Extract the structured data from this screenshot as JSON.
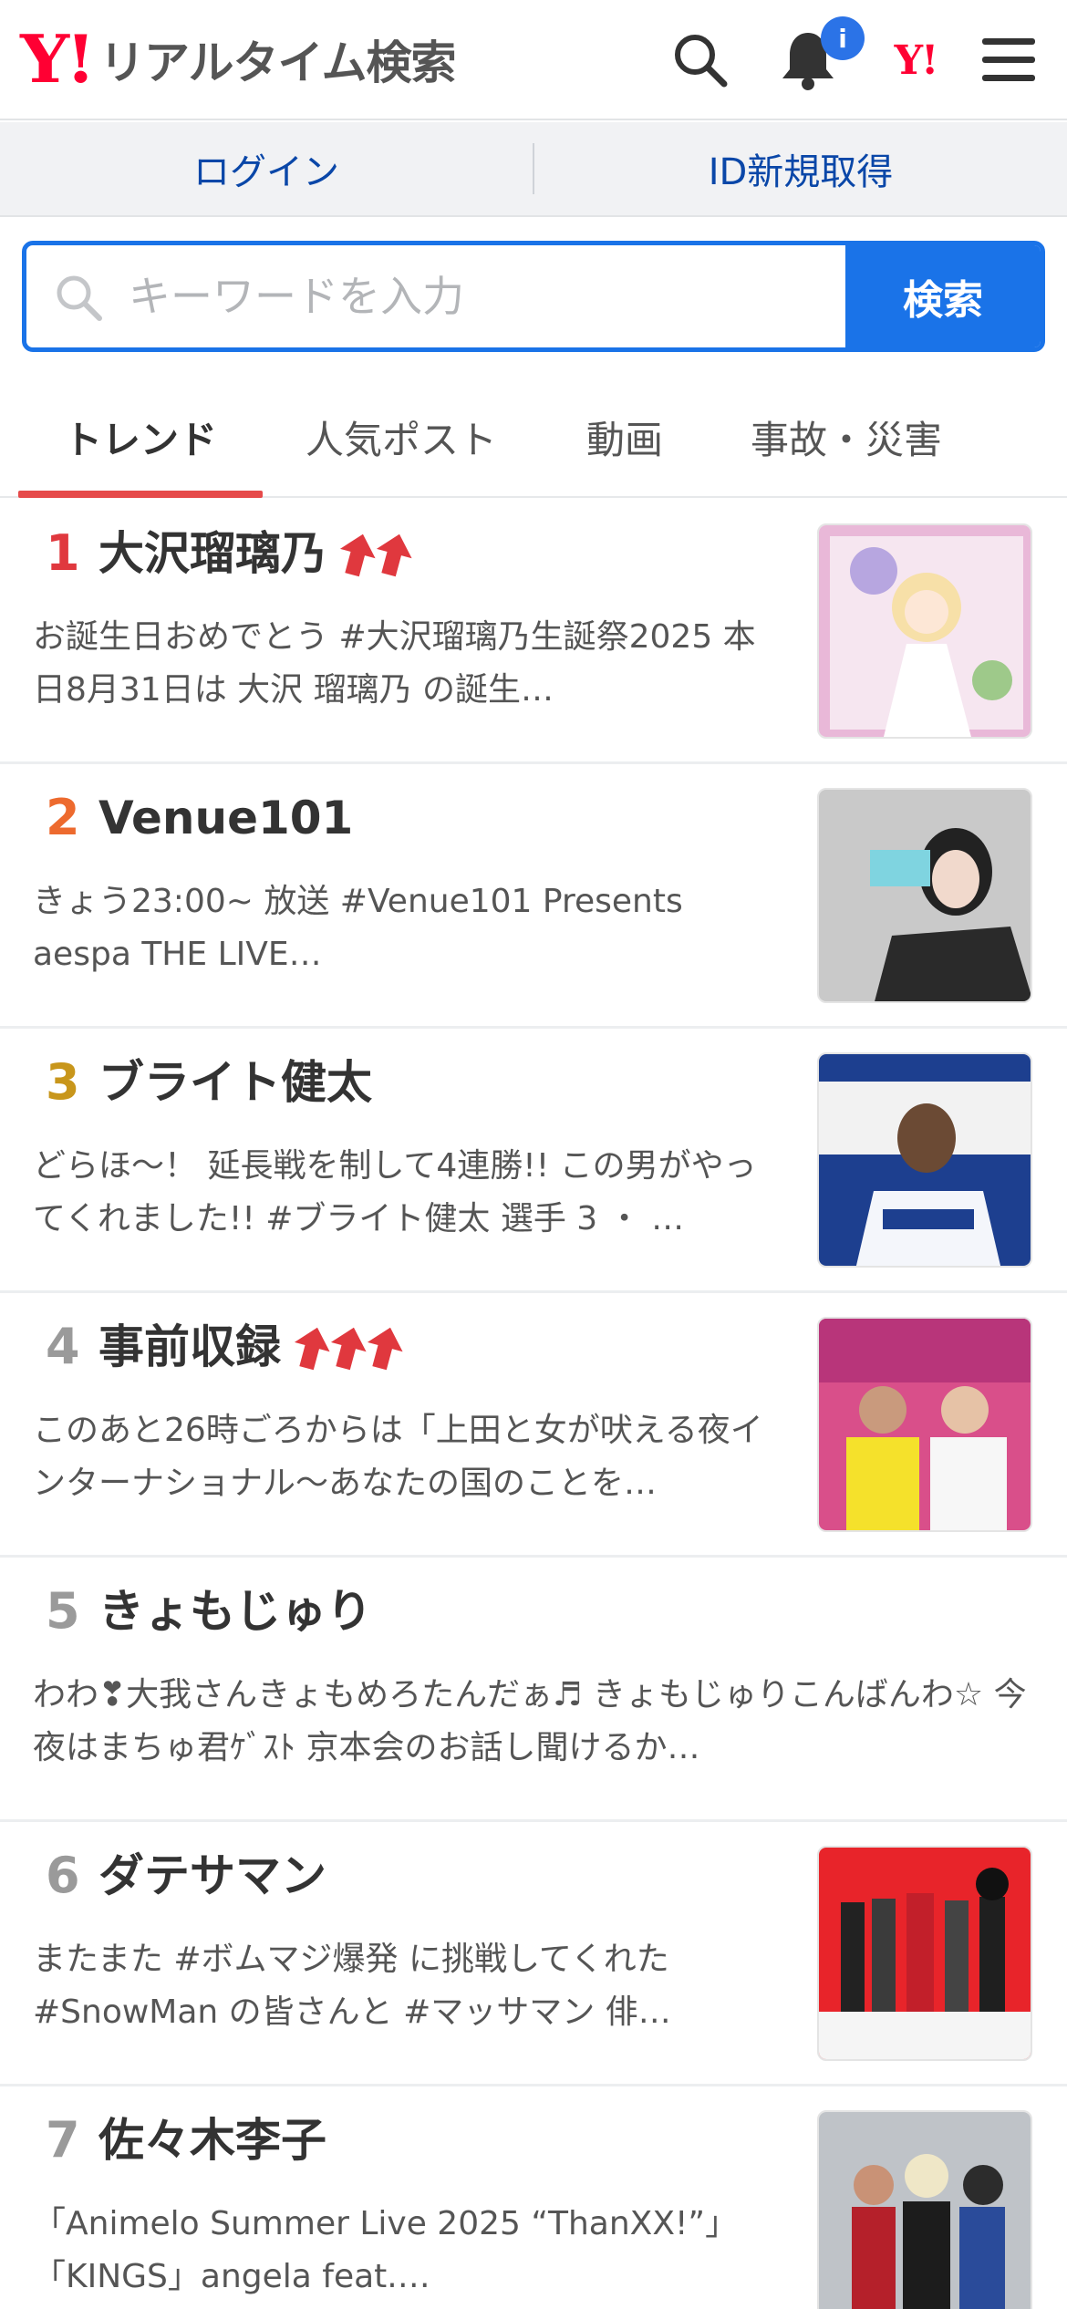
{
  "header": {
    "logo_mark": "Y!",
    "logo_text": "リアルタイム検索",
    "notification_badge": "i",
    "yahoo_mark": "Y!"
  },
  "account": {
    "login_label": "ログイン",
    "register_label": "ID新規取得"
  },
  "search": {
    "placeholder": "キーワードを入力",
    "button_label": "検索"
  },
  "tabs": [
    {
      "label": "トレンド",
      "active": true
    },
    {
      "label": "人気ポスト",
      "active": false
    },
    {
      "label": "動画",
      "active": false
    },
    {
      "label": "事故・災害",
      "active": false
    }
  ],
  "colors": {
    "brand_red": "#ff0033",
    "accent_blue": "#1a73e8",
    "link_blue": "#0a47a8",
    "tab_underline": "#e64a4a",
    "rank_1": "#e0383e",
    "rank_2": "#ed6a2e",
    "rank_3": "#c8961b",
    "rank_other": "#9a9a9a",
    "trend_arrow": "#e0383e"
  },
  "trends": [
    {
      "rank": "1",
      "title": "大沢瑠璃乃",
      "arrows": 2,
      "has_thumb": true,
      "description": "お誕生日おめでとう #大沢瑠璃乃生誕祭2025 本日8月31日は 大沢 瑠璃乃 の誕生…"
    },
    {
      "rank": "2",
      "title": "Venue101",
      "arrows": 0,
      "has_thumb": true,
      "description": "きょう23:00~ 放送 #Venue101 Presents aespa THE LIVE…"
    },
    {
      "rank": "3",
      "title": "ブライト健太",
      "arrows": 0,
      "has_thumb": true,
      "description": "どらほ〜！ 延長戦を制して4連勝!! この男がやってくれました!! #ブライト健太 選手 3 ・ …"
    },
    {
      "rank": "4",
      "title": "事前収録",
      "arrows": 3,
      "has_thumb": true,
      "description": "このあと26時ごろからは「上田と女が吠える夜インターナショナル〜あなたの国のことを…"
    },
    {
      "rank": "5",
      "title": "きょもじゅり",
      "arrows": 0,
      "has_thumb": false,
      "description": "わわ❣大我さんきょもめろたんだぁ♬ きょもじゅりこんばんわ☆ 今夜はまちゅ君ｹﾞｽﾄ 京本会のお話し聞けるか…"
    },
    {
      "rank": "6",
      "title": "ダテサマン",
      "arrows": 0,
      "has_thumb": true,
      "description": "またまた #ボムマジ爆発 に挑戦してくれた #SnowMan の皆さんと #マッサマン  俳…"
    },
    {
      "rank": "7",
      "title": "佐々木李子",
      "arrows": 0,
      "has_thumb": true,
      "description": "「Animelo Summer Live 2025 “ThanXX!”」 「KINGS」angela feat.…"
    }
  ]
}
